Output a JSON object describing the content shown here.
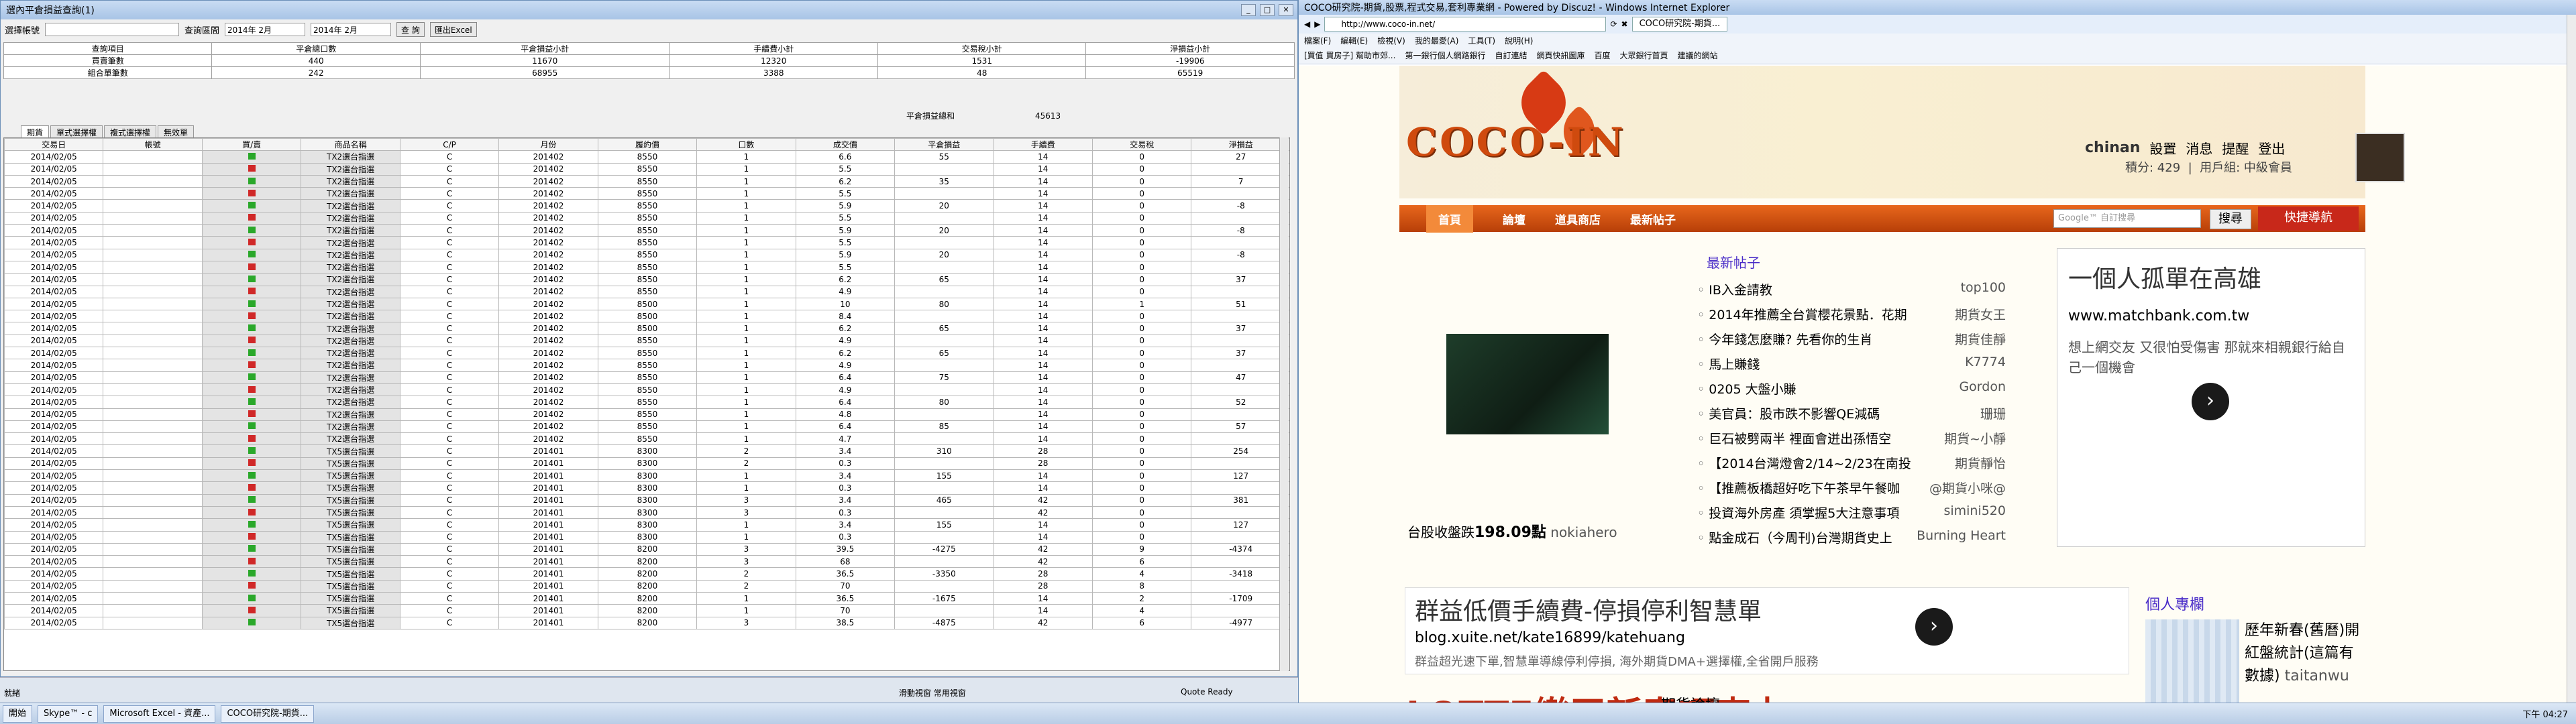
{
  "left": {
    "title": "選內平倉損益查詢(1)",
    "accounts_label": "選擇帳號",
    "date_label": "查詢區間",
    "date_from": "2014年 2月",
    "date_to": "2014年 2月",
    "query_btn": "查 詢",
    "export_btn": "匯出Excel",
    "summary": {
      "headers": [
        "查詢項目",
        "平倉總口數",
        "平倉損益小計",
        "手續費小計",
        "交易稅小計",
        "淨損益小計"
      ],
      "rows": [
        [
          "買賣筆數",
          "440",
          "11670",
          "12320",
          "1531",
          "-19906"
        ],
        [
          "組合單筆數",
          "242",
          "68955",
          "3388",
          "48",
          "65519"
        ]
      ],
      "total_label": "平倉損益總和",
      "total_value": "45613"
    },
    "tabs": [
      "期貨",
      "單式選擇權",
      "複式選擇權",
      "無效單"
    ],
    "grid_headers": [
      "交易日",
      "帳號",
      "買/賣",
      "商品名稱",
      "C/P",
      "月份",
      "履約價",
      "口數",
      "成交價",
      "平倉損益",
      "手續費",
      "交易稅",
      "淨損益"
    ],
    "rows": [
      [
        "2014/02/05",
        "",
        "g",
        "TX2選台指選",
        "C",
        "201402",
        "8550",
        "1",
        "6.6",
        "55",
        "14",
        "0",
        "27"
      ],
      [
        "2014/02/05",
        "",
        "r",
        "TX2選台指選",
        "C",
        "201402",
        "8550",
        "1",
        "5.5",
        "",
        "14",
        "0",
        ""
      ],
      [
        "2014/02/05",
        "",
        "g",
        "TX2選台指選",
        "C",
        "201402",
        "8550",
        "1",
        "6.2",
        "35",
        "14",
        "0",
        "7"
      ],
      [
        "2014/02/05",
        "",
        "r",
        "TX2選台指選",
        "C",
        "201402",
        "8550",
        "1",
        "5.5",
        "",
        "14",
        "0",
        ""
      ],
      [
        "2014/02/05",
        "",
        "g",
        "TX2選台指選",
        "C",
        "201402",
        "8550",
        "1",
        "5.9",
        "20",
        "14",
        "0",
        "-8"
      ],
      [
        "2014/02/05",
        "",
        "r",
        "TX2選台指選",
        "C",
        "201402",
        "8550",
        "1",
        "5.5",
        "",
        "14",
        "0",
        ""
      ],
      [
        "2014/02/05",
        "",
        "g",
        "TX2選台指選",
        "C",
        "201402",
        "8550",
        "1",
        "5.9",
        "20",
        "14",
        "0",
        "-8"
      ],
      [
        "2014/02/05",
        "",
        "r",
        "TX2選台指選",
        "C",
        "201402",
        "8550",
        "1",
        "5.5",
        "",
        "14",
        "0",
        ""
      ],
      [
        "2014/02/05",
        "",
        "g",
        "TX2選台指選",
        "C",
        "201402",
        "8550",
        "1",
        "5.9",
        "20",
        "14",
        "0",
        "-8"
      ],
      [
        "2014/02/05",
        "",
        "r",
        "TX2選台指選",
        "C",
        "201402",
        "8550",
        "1",
        "5.5",
        "",
        "14",
        "0",
        ""
      ],
      [
        "2014/02/05",
        "",
        "g",
        "TX2選台指選",
        "C",
        "201402",
        "8550",
        "1",
        "6.2",
        "65",
        "14",
        "0",
        "37"
      ],
      [
        "2014/02/05",
        "",
        "r",
        "TX2選台指選",
        "C",
        "201402",
        "8550",
        "1",
        "4.9",
        "",
        "14",
        "0",
        ""
      ],
      [
        "2014/02/05",
        "",
        "g",
        "TX2選台指選",
        "C",
        "201402",
        "8500",
        "1",
        "10",
        "80",
        "14",
        "1",
        "51"
      ],
      [
        "2014/02/05",
        "",
        "r",
        "TX2選台指選",
        "C",
        "201402",
        "8500",
        "1",
        "8.4",
        "",
        "14",
        "0",
        ""
      ],
      [
        "2014/02/05",
        "",
        "g",
        "TX2選台指選",
        "C",
        "201402",
        "8500",
        "1",
        "6.2",
        "65",
        "14",
        "0",
        "37"
      ],
      [
        "2014/02/05",
        "",
        "r",
        "TX2選台指選",
        "C",
        "201402",
        "8550",
        "1",
        "4.9",
        "",
        "14",
        "0",
        ""
      ],
      [
        "2014/02/05",
        "",
        "g",
        "TX2選台指選",
        "C",
        "201402",
        "8550",
        "1",
        "6.2",
        "65",
        "14",
        "0",
        "37"
      ],
      [
        "2014/02/05",
        "",
        "r",
        "TX2選台指選",
        "C",
        "201402",
        "8550",
        "1",
        "4.9",
        "",
        "14",
        "0",
        ""
      ],
      [
        "2014/02/05",
        "",
        "g",
        "TX2選台指選",
        "C",
        "201402",
        "8550",
        "1",
        "6.4",
        "75",
        "14",
        "0",
        "47"
      ],
      [
        "2014/02/05",
        "",
        "r",
        "TX2選台指選",
        "C",
        "201402",
        "8550",
        "1",
        "4.9",
        "",
        "14",
        "0",
        ""
      ],
      [
        "2014/02/05",
        "",
        "g",
        "TX2選台指選",
        "C",
        "201402",
        "8550",
        "1",
        "6.4",
        "80",
        "14",
        "0",
        "52"
      ],
      [
        "2014/02/05",
        "",
        "r",
        "TX2選台指選",
        "C",
        "201402",
        "8550",
        "1",
        "4.8",
        "",
        "14",
        "0",
        ""
      ],
      [
        "2014/02/05",
        "",
        "g",
        "TX2選台指選",
        "C",
        "201402",
        "8550",
        "1",
        "6.4",
        "85",
        "14",
        "0",
        "57"
      ],
      [
        "2014/02/05",
        "",
        "r",
        "TX2選台指選",
        "C",
        "201402",
        "8550",
        "1",
        "4.7",
        "",
        "14",
        "0",
        ""
      ],
      [
        "2014/02/05",
        "",
        "g",
        "TX5選台指選",
        "C",
        "201401",
        "8300",
        "2",
        "3.4",
        "310",
        "28",
        "0",
        "254"
      ],
      [
        "2014/02/05",
        "",
        "r",
        "TX5選台指選",
        "C",
        "201401",
        "8300",
        "2",
        "0.3",
        "",
        "28",
        "0",
        ""
      ],
      [
        "2014/02/05",
        "",
        "g",
        "TX5選台指選",
        "C",
        "201401",
        "8300",
        "1",
        "3.4",
        "155",
        "14",
        "0",
        "127"
      ],
      [
        "2014/02/05",
        "",
        "r",
        "TX5選台指選",
        "C",
        "201401",
        "8300",
        "1",
        "0.3",
        "",
        "14",
        "0",
        ""
      ],
      [
        "2014/02/05",
        "",
        "g",
        "TX5選台指選",
        "C",
        "201401",
        "8300",
        "3",
        "3.4",
        "465",
        "42",
        "0",
        "381"
      ],
      [
        "2014/02/05",
        "",
        "r",
        "TX5選台指選",
        "C",
        "201401",
        "8300",
        "3",
        "0.3",
        "",
        "42",
        "0",
        ""
      ],
      [
        "2014/02/05",
        "",
        "g",
        "TX5選台指選",
        "C",
        "201401",
        "8300",
        "1",
        "3.4",
        "155",
        "14",
        "0",
        "127"
      ],
      [
        "2014/02/05",
        "",
        "r",
        "TX5選台指選",
        "C",
        "201401",
        "8300",
        "1",
        "0.3",
        "",
        "14",
        "0",
        ""
      ],
      [
        "2014/02/05",
        "",
        "g",
        "TX5選台指選",
        "C",
        "201401",
        "8200",
        "3",
        "39.5",
        "-4275",
        "42",
        "9",
        "-4374"
      ],
      [
        "2014/02/05",
        "",
        "r",
        "TX5選台指選",
        "C",
        "201401",
        "8200",
        "3",
        "68",
        "",
        "42",
        "6",
        ""
      ],
      [
        "2014/02/05",
        "",
        "g",
        "TX5選台指選",
        "C",
        "201401",
        "8200",
        "2",
        "36.5",
        "-3350",
        "28",
        "4",
        "-3418"
      ],
      [
        "2014/02/05",
        "",
        "r",
        "TX5選台指選",
        "C",
        "201401",
        "8200",
        "2",
        "70",
        "",
        "28",
        "8",
        ""
      ],
      [
        "2014/02/05",
        "",
        "g",
        "TX5選台指選",
        "C",
        "201401",
        "8200",
        "1",
        "36.5",
        "-1675",
        "14",
        "2",
        "-1709"
      ],
      [
        "2014/02/05",
        "",
        "r",
        "TX5選台指選",
        "C",
        "201401",
        "8200",
        "1",
        "70",
        "",
        "14",
        "4",
        ""
      ],
      [
        "2014/02/05",
        "",
        "g",
        "TX5選台指選",
        "C",
        "201401",
        "8200",
        "3",
        "38.5",
        "-4875",
        "42",
        "6",
        "-4977"
      ]
    ]
  },
  "right": {
    "title": "COCO研究院-期貨,股票,程式交易,套利專業網 - Powered by Discuz! - Windows Internet Explorer",
    "url": "http://www.coco-in.net/",
    "tab": "COCO研究院-期貨...",
    "menu": [
      "檔案(F)",
      "編輯(E)",
      "檢視(V)",
      "我的最愛(A)",
      "工具(T)",
      "說明(H)"
    ],
    "favs": [
      "[買值 買房子] 幫助市郊...",
      "第一銀行個人網路銀行",
      "自訂連結",
      "網頁快訊圖庫",
      "百度",
      "大眾銀行首頁",
      "建議的網站"
    ],
    "logo": "COCO-IN",
    "user": "chinan",
    "user_links": [
      "設置",
      "消息",
      "提醒",
      "登出"
    ],
    "points": "積分: 429",
    "group": "用戶組: 中級會員",
    "nav": [
      "首頁",
      "論壇",
      "道具商店",
      "最新帖子"
    ],
    "search_ph": "Google™ 自訂搜尋",
    "search_btn": "搜尋",
    "quick_nav": "快捷導航",
    "news_title": "最新帖子",
    "news": [
      [
        "IB入金請教",
        "top100"
      ],
      [
        "2014年推薦全台賞櫻花景點．花期",
        "期貨女王"
      ],
      [
        "今年錢怎麼賺? 先看你的生肖",
        "期貨佳靜"
      ],
      [
        "馬上賺錢",
        "K7774"
      ],
      [
        "0205 大盤小賺",
        "Gordon"
      ],
      [
        "美官員：股市跌不影響QE減碼",
        "珊珊"
      ],
      [
        "巨石被劈兩半 裡面會迸出孫悟空",
        "期貨~小靜"
      ],
      [
        "【2014台灣燈會2/14~2/23在南投",
        "期貨靜怡"
      ],
      [
        "【推薦板橋超好吃下午茶早午餐咖",
        "@期貨小咪@"
      ],
      [
        "投資海外房產 須掌握5大注意事項",
        "simini520"
      ],
      [
        "點金成石（今周刊)台灣期貨史上",
        "Burning Heart"
      ]
    ],
    "index_text": "台股收盤跌",
    "index_val": "198.09點",
    "index_user": "nokiahero",
    "ad1_title": "一個人孤單在高雄",
    "ad1_url": "www.matchbank.com.tw",
    "ad1_desc": "想上網交友 又很怕受傷害 那就來相親銀行給自己一個機會",
    "ad2_title": "群益低價手續費-停損停利智慧單",
    "ad2_url": "blog.xuite.net/kate16899/katehuang",
    "ad2_desc": "群益超光速下單,智慧單導線停利停損, 海外期貨DMA+選擇權,全省開戶服務",
    "personal": "個人專欄",
    "side_text": "歷年新春(舊曆)開紅盤統計(這篇有數據)",
    "side_user": "taitanwu",
    "lotte": "LOTTE樂天新春巧克力",
    "lotte2": "期貨論壇"
  },
  "taskbar": {
    "start": "開始",
    "items": [
      "Skype™ - c",
      "Microsoft Excel - 資產...",
      "COCO研究院-期貨..."
    ],
    "clock": "下午 04:27",
    "quote": "Quote Ready"
  },
  "status": {
    "left": "就緒",
    "mid": "滑動視窗 常用視窗"
  }
}
